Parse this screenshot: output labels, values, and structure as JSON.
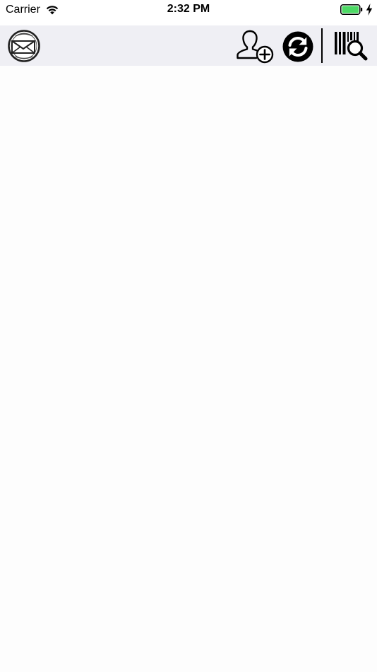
{
  "status_bar": {
    "carrier": "Carrier",
    "time": "2:32 PM",
    "wifi_icon": "wifi-icon",
    "battery_icon": "battery-icon",
    "battery_level": 1.0,
    "charging_icon": "lightning-bolt-icon"
  },
  "toolbar": {
    "background": "#efeff4",
    "left_button_icon": "envelope-globe-icon",
    "right_buttons": [
      {
        "icon": "add-user-icon"
      },
      {
        "icon": "sync-icon"
      },
      {
        "icon": "barcode-search-icon"
      }
    ]
  },
  "colors": {
    "battery_fill": "#4cd964",
    "icon": "#000000",
    "content_background": "#fdfdfd"
  }
}
